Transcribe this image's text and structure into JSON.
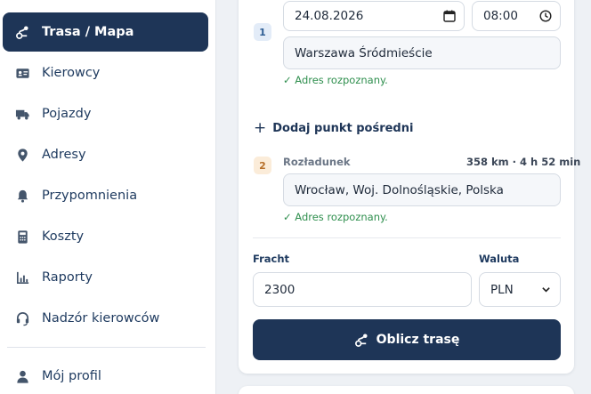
{
  "colors": {
    "primary": "#1e3557",
    "success": "#2f8f4e",
    "accent_orange": "#b7702a"
  },
  "sidebar": {
    "items": [
      {
        "label": "Trasa / Mapa",
        "icon": "route-icon",
        "active": true
      },
      {
        "label": "Kierowcy",
        "icon": "id-card-icon"
      },
      {
        "label": "Pojazdy",
        "icon": "truck-icon"
      },
      {
        "label": "Adresy",
        "icon": "map-pin-icon"
      },
      {
        "label": "Przypomnienia",
        "icon": "bell-icon"
      },
      {
        "label": "Koszty",
        "icon": "calculator-icon"
      },
      {
        "label": "Raporty",
        "icon": "chart-icon"
      },
      {
        "label": "Nadzór kierowców",
        "icon": "headset-icon"
      },
      {
        "label": "Mój profil",
        "icon": "user-icon"
      }
    ]
  },
  "route": {
    "point1": {
      "number": "1",
      "date": "24.08.2026",
      "time": "08:00",
      "address": "Warszawa Śródmieście",
      "status": "✓ Adres rozpoznany."
    },
    "add_waypoint": "Dodaj punkt pośredni",
    "point2": {
      "number": "2",
      "label": "Rozładunek",
      "distance": "358 km · 4 h 52 min",
      "address": "Wrocław, Woj. Dolnośląskie, Polska",
      "status": "✓ Adres rozpoznany."
    }
  },
  "freight": {
    "label": "Fracht",
    "value": "2300",
    "currency_label": "Waluta",
    "currency_value": "PLN"
  },
  "calculate_button": "Oblicz trasę"
}
